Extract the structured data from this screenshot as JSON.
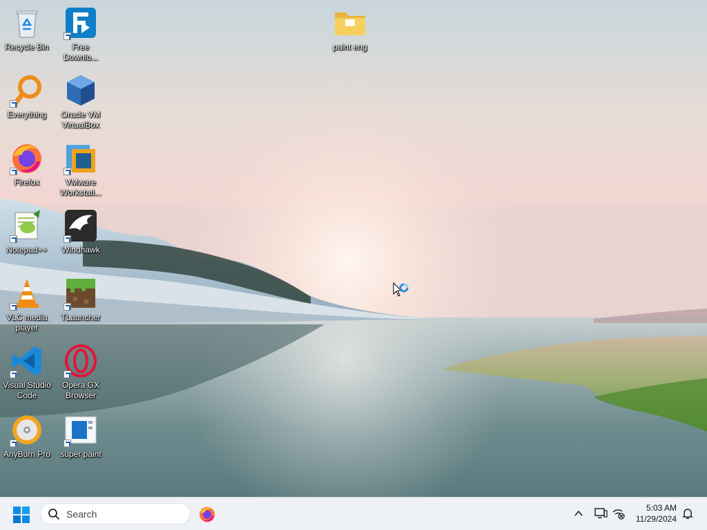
{
  "desktop": {
    "icons": [
      {
        "id": "recycle-bin",
        "label": "Recycle Bin"
      },
      {
        "id": "free-download",
        "label": "Free Downlo..."
      },
      {
        "id": "paint-eng",
        "label": "paint eng"
      },
      {
        "id": "everything",
        "label": "Everything"
      },
      {
        "id": "virtualbox",
        "label": "Oracle VM VirtualBox"
      },
      {
        "id": "firefox",
        "label": "Firefox"
      },
      {
        "id": "vmware",
        "label": "VMware Workstati..."
      },
      {
        "id": "notepadpp",
        "label": "Notepad++"
      },
      {
        "id": "windhawk",
        "label": "Windhawk"
      },
      {
        "id": "vlc",
        "label": "VLC media player"
      },
      {
        "id": "tlauncher",
        "label": "TLauncher"
      },
      {
        "id": "vscode",
        "label": "Visual Studio Code"
      },
      {
        "id": "operagx",
        "label": "Opera GX Browser"
      },
      {
        "id": "anyburn",
        "label": "AnyBurn Pro"
      },
      {
        "id": "superpaint",
        "label": "super paint"
      }
    ]
  },
  "taskbar": {
    "search_placeholder": "Search",
    "pinned": [
      {
        "icon": "firefox-icon"
      }
    ],
    "clock": {
      "time": "5:03 AM",
      "date": "11/29/2024"
    }
  },
  "colors": {
    "taskbar_bg": "#eef1f5",
    "accent": "#0078d4"
  }
}
